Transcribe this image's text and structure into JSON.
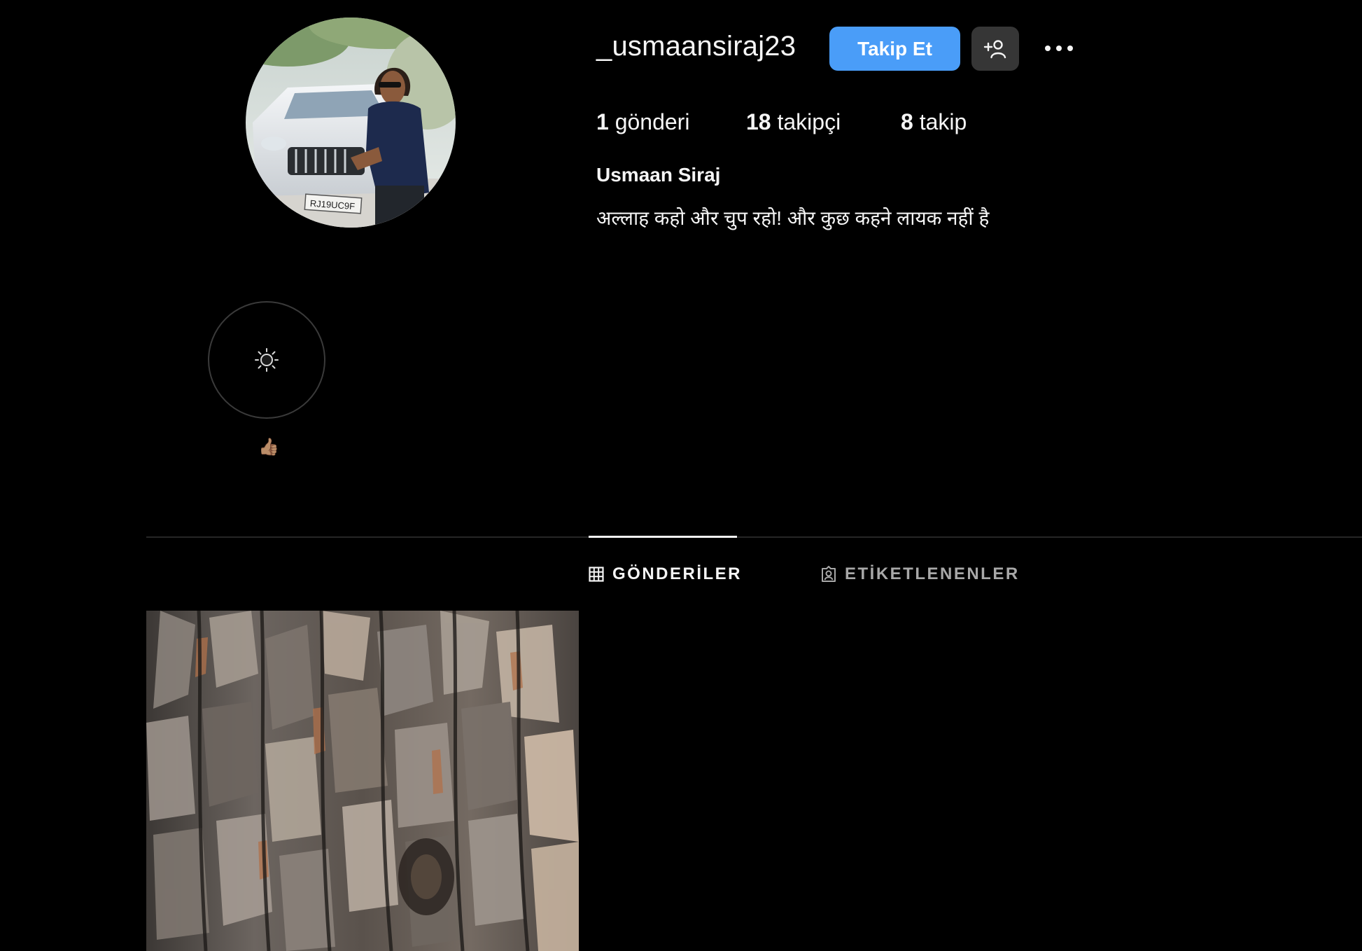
{
  "profile": {
    "username": "_usmaansiraj23",
    "display_name": "Usmaan Siraj",
    "bio": "अल्लाह कहो और चुप रहो! और कुछ कहने लायक नहीं है",
    "avatar_plate_text": "RJ19UC9F"
  },
  "actions": {
    "follow_label": "Takip Et",
    "suggest_icon": "add-person-icon",
    "more_icon": "more-horizontal-icon"
  },
  "stats": {
    "posts_count": "1",
    "posts_label": "gönderi",
    "followers_count": "18",
    "followers_label": "takipçi",
    "following_count": "8",
    "following_label": "takip"
  },
  "highlights": [
    {
      "label": "👍🏽",
      "icon": "sun-icon"
    }
  ],
  "tabs": [
    {
      "label": "GÖNDERİLER",
      "icon": "grid-icon",
      "active": true
    },
    {
      "label": "ETİKETLENENLER",
      "icon": "tagged-icon",
      "active": false
    }
  ],
  "posts": [
    {
      "description": "tree-bark-photo"
    }
  ],
  "colors": {
    "background": "#000000",
    "primary_button": "#4a9df8",
    "secondary_button": "#363636",
    "text": "#f5f5f5",
    "muted_text": "#a8a8a8",
    "divider": "#262626"
  }
}
